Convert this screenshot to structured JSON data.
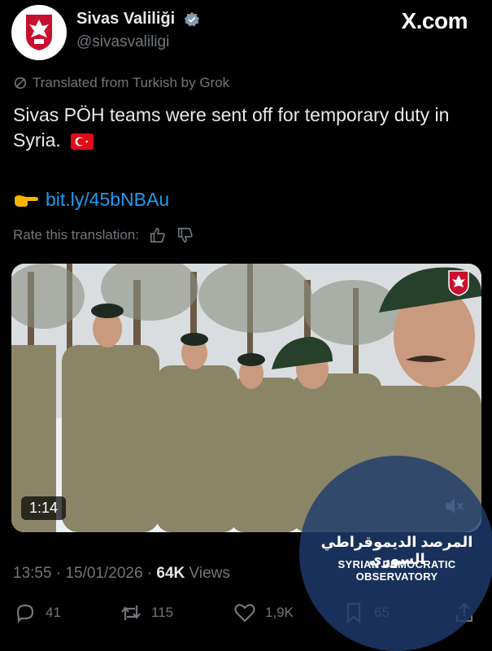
{
  "account": {
    "display_name": "Sivas Valiliği",
    "handle": "@sivasvaliligi",
    "verified": true
  },
  "site_brand": "X.com",
  "translation_notice": "Translated from Turkish by Grok",
  "tweet": {
    "text": "Sivas PÖH teams were sent off for temporary duty in Syria.",
    "flag_icon": "turkey-flag-icon",
    "pointer_icon": "backhand-index-pointing-right-icon",
    "link": "bit.ly/45bNBAu"
  },
  "rate_translation": {
    "label": "Rate this translation:",
    "up_icon": "thumbs-up-icon",
    "down_icon": "thumbs-down-icon"
  },
  "media": {
    "duration": "1:14",
    "mute_icon": "speaker-muted-icon"
  },
  "meta": {
    "timestamp": "13:55 · 15/01/2026 · ",
    "views_count": "64K",
    "views_label": " Views"
  },
  "actions": {
    "replies": "41",
    "reposts": "115",
    "likes": "1,9K",
    "bookmarks": "65"
  },
  "watermark": {
    "arabic": "المرصد الديموقراطي السوري",
    "english": "SYRIAN DEMOCRATIC OBSERVATORY"
  },
  "colors": {
    "background": "#000000",
    "text": "#e7e9ea",
    "muted": "#71767b",
    "link": "#1d9bf0",
    "verified": "#829aab"
  }
}
